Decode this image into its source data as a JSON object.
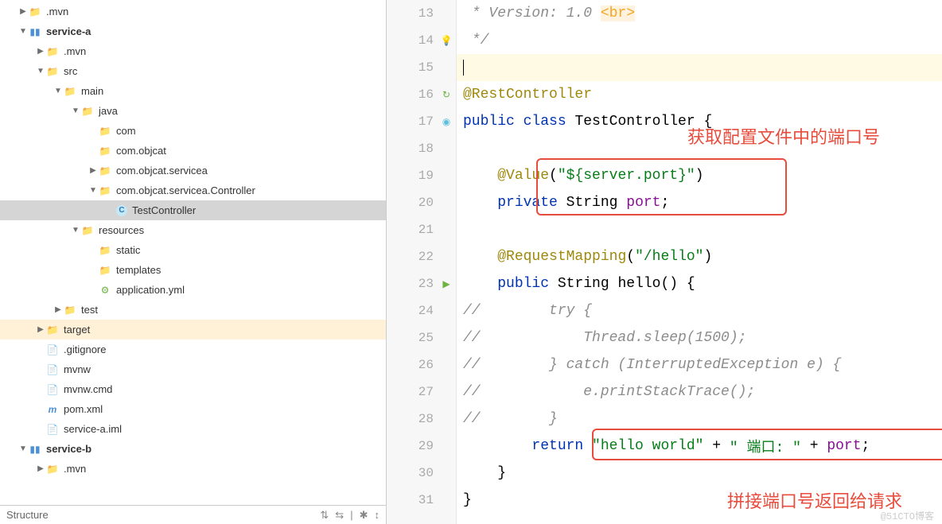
{
  "tree": [
    {
      "indent": 1,
      "arrow": "▶",
      "icon": "folder-gray",
      "label": ".mvn",
      "bold": false
    },
    {
      "indent": 1,
      "arrow": "▼",
      "icon": "folder-module",
      "label": "service-a",
      "bold": true
    },
    {
      "indent": 2,
      "arrow": "▶",
      "icon": "folder-gray",
      "label": ".mvn",
      "bold": false
    },
    {
      "indent": 2,
      "arrow": "▼",
      "icon": "folder-blue",
      "label": "src",
      "bold": false
    },
    {
      "indent": 3,
      "arrow": "▼",
      "icon": "folder-gray",
      "label": "main",
      "bold": false
    },
    {
      "indent": 4,
      "arrow": "▼",
      "icon": "folder-blue",
      "label": "java",
      "bold": false
    },
    {
      "indent": 5,
      "arrow": "",
      "icon": "folder-gray",
      "label": "com",
      "bold": false
    },
    {
      "indent": 5,
      "arrow": "",
      "icon": "folder-gray",
      "label": "com.objcat",
      "bold": false
    },
    {
      "indent": 5,
      "arrow": "▶",
      "icon": "folder-gray",
      "label": "com.objcat.servicea",
      "bold": false
    },
    {
      "indent": 5,
      "arrow": "▼",
      "icon": "folder-gray",
      "label": "com.objcat.servicea.Controller",
      "bold": false
    },
    {
      "indent": 6,
      "arrow": "",
      "icon": "class",
      "label": "TestController",
      "bold": false,
      "selected": true
    },
    {
      "indent": 4,
      "arrow": "▼",
      "icon": "folder-gray",
      "label": "resources",
      "bold": false
    },
    {
      "indent": 5,
      "arrow": "",
      "icon": "folder-gray",
      "label": "static",
      "bold": false
    },
    {
      "indent": 5,
      "arrow": "",
      "icon": "folder-gray",
      "label": "templates",
      "bold": false
    },
    {
      "indent": 5,
      "arrow": "",
      "icon": "yml",
      "label": "application.yml",
      "bold": false
    },
    {
      "indent": 3,
      "arrow": "▶",
      "icon": "folder-gray",
      "label": "test",
      "bold": false
    },
    {
      "indent": 2,
      "arrow": "▶",
      "icon": "folder-orange",
      "label": "target",
      "bold": false,
      "target": true
    },
    {
      "indent": 2,
      "arrow": "",
      "icon": "file",
      "label": ".gitignore",
      "bold": false
    },
    {
      "indent": 2,
      "arrow": "",
      "icon": "file",
      "label": "mvnw",
      "bold": false
    },
    {
      "indent": 2,
      "arrow": "",
      "icon": "file",
      "label": "mvnw.cmd",
      "bold": false
    },
    {
      "indent": 2,
      "arrow": "",
      "icon": "maven",
      "label": "pom.xml",
      "bold": false
    },
    {
      "indent": 2,
      "arrow": "",
      "icon": "file",
      "label": "service-a.iml",
      "bold": false
    },
    {
      "indent": 1,
      "arrow": "▼",
      "icon": "folder-module",
      "label": "service-b",
      "bold": true
    },
    {
      "indent": 2,
      "arrow": "▶",
      "icon": "folder-gray",
      "label": ".mvn",
      "bold": false
    }
  ],
  "structure_label": "Structure",
  "code": {
    "lines": [
      {
        "n": 13,
        "tokens": [
          {
            "t": " * Version: 1.0 ",
            "c": "comment"
          },
          {
            "t": "<br>",
            "c": "tag"
          }
        ]
      },
      {
        "n": 14,
        "tokens": [
          {
            "t": " */",
            "c": "comment"
          }
        ],
        "marker": "bulb"
      },
      {
        "n": 15,
        "highlight": true,
        "cursor": true,
        "tokens": []
      },
      {
        "n": 16,
        "marker": "green",
        "tokens": [
          {
            "t": "@RestController",
            "c": "ann"
          }
        ]
      },
      {
        "n": 17,
        "marker": "cyan",
        "tokens": [
          {
            "t": "public ",
            "c": "kw"
          },
          {
            "t": "class ",
            "c": "kw"
          },
          {
            "t": "TestController {",
            "c": "type"
          }
        ]
      },
      {
        "n": 18,
        "tokens": []
      },
      {
        "n": 19,
        "tokens": [
          {
            "t": "    ",
            "c": ""
          },
          {
            "t": "@Value",
            "c": "ann"
          },
          {
            "t": "(",
            "c": "type"
          },
          {
            "t": "\"${server.port}\"",
            "c": "str"
          },
          {
            "t": ")",
            "c": "type"
          }
        ]
      },
      {
        "n": 20,
        "tokens": [
          {
            "t": "    ",
            "c": ""
          },
          {
            "t": "private ",
            "c": "kw"
          },
          {
            "t": "String ",
            "c": "type"
          },
          {
            "t": "port",
            "c": "field"
          },
          {
            "t": ";",
            "c": "type"
          }
        ]
      },
      {
        "n": 21,
        "tokens": []
      },
      {
        "n": 22,
        "tokens": [
          {
            "t": "    ",
            "c": ""
          },
          {
            "t": "@RequestMapping",
            "c": "ann"
          },
          {
            "t": "(",
            "c": "type"
          },
          {
            "t": "\"/hello\"",
            "c": "str"
          },
          {
            "t": ")",
            "c": "type"
          }
        ]
      },
      {
        "n": 23,
        "marker": "play",
        "tokens": [
          {
            "t": "    ",
            "c": ""
          },
          {
            "t": "public ",
            "c": "kw"
          },
          {
            "t": "String hello() {",
            "c": "type"
          }
        ]
      },
      {
        "n": 24,
        "tokens": [
          {
            "t": "//        try {",
            "c": "comment"
          }
        ]
      },
      {
        "n": 25,
        "tokens": [
          {
            "t": "//            Thread.sleep(1500);",
            "c": "comment"
          }
        ]
      },
      {
        "n": 26,
        "tokens": [
          {
            "t": "//        } catch (InterruptedException e) {",
            "c": "comment"
          }
        ]
      },
      {
        "n": 27,
        "tokens": [
          {
            "t": "//            e.printStackTrace();",
            "c": "comment"
          }
        ]
      },
      {
        "n": 28,
        "tokens": [
          {
            "t": "//        }",
            "c": "comment"
          }
        ]
      },
      {
        "n": 29,
        "tokens": [
          {
            "t": "        ",
            "c": ""
          },
          {
            "t": "return ",
            "c": "kw"
          },
          {
            "t": "\"hello world\"",
            "c": "str"
          },
          {
            "t": " + ",
            "c": "type"
          },
          {
            "t": "\" 端口: \"",
            "c": "str"
          },
          {
            "t": " + ",
            "c": "type"
          },
          {
            "t": "port",
            "c": "field"
          },
          {
            "t": ";",
            "c": "type"
          }
        ]
      },
      {
        "n": 30,
        "tokens": [
          {
            "t": "    }",
            "c": "type"
          }
        ]
      },
      {
        "n": 31,
        "tokens": [
          {
            "t": "}",
            "c": "type"
          }
        ]
      }
    ]
  },
  "annotations": {
    "top": "获取配置文件中的端口号",
    "bottom": "拼接端口号返回给请求"
  },
  "watermark": "@51CTO博客"
}
